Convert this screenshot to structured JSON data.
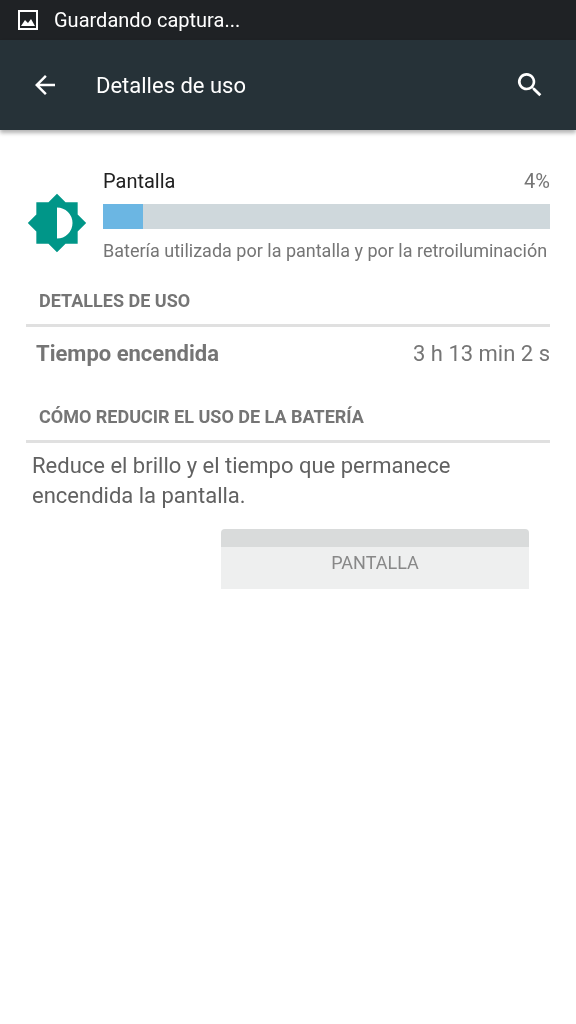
{
  "status_bar": {
    "notification": "Guardando captura..."
  },
  "toolbar": {
    "title": "Detalles de uso"
  },
  "app_usage": {
    "name": "Pantalla",
    "percent": "4%",
    "level": 0.09,
    "description": "Batería utilizada por la pantalla y por la retroiluminación"
  },
  "sections": [
    {
      "heading": "DETALLES DE USO",
      "kind": "detail",
      "label": "Tiempo encendida",
      "value": "3 h 13 min 2 s"
    },
    {
      "heading": "CÓMO REDUCIR EL USO DE LA BATERÍA",
      "kind": "tip",
      "text": "Reduce el brillo y el tiempo que permanece encendida la pantalla.",
      "button": "PANTALLA"
    }
  ]
}
